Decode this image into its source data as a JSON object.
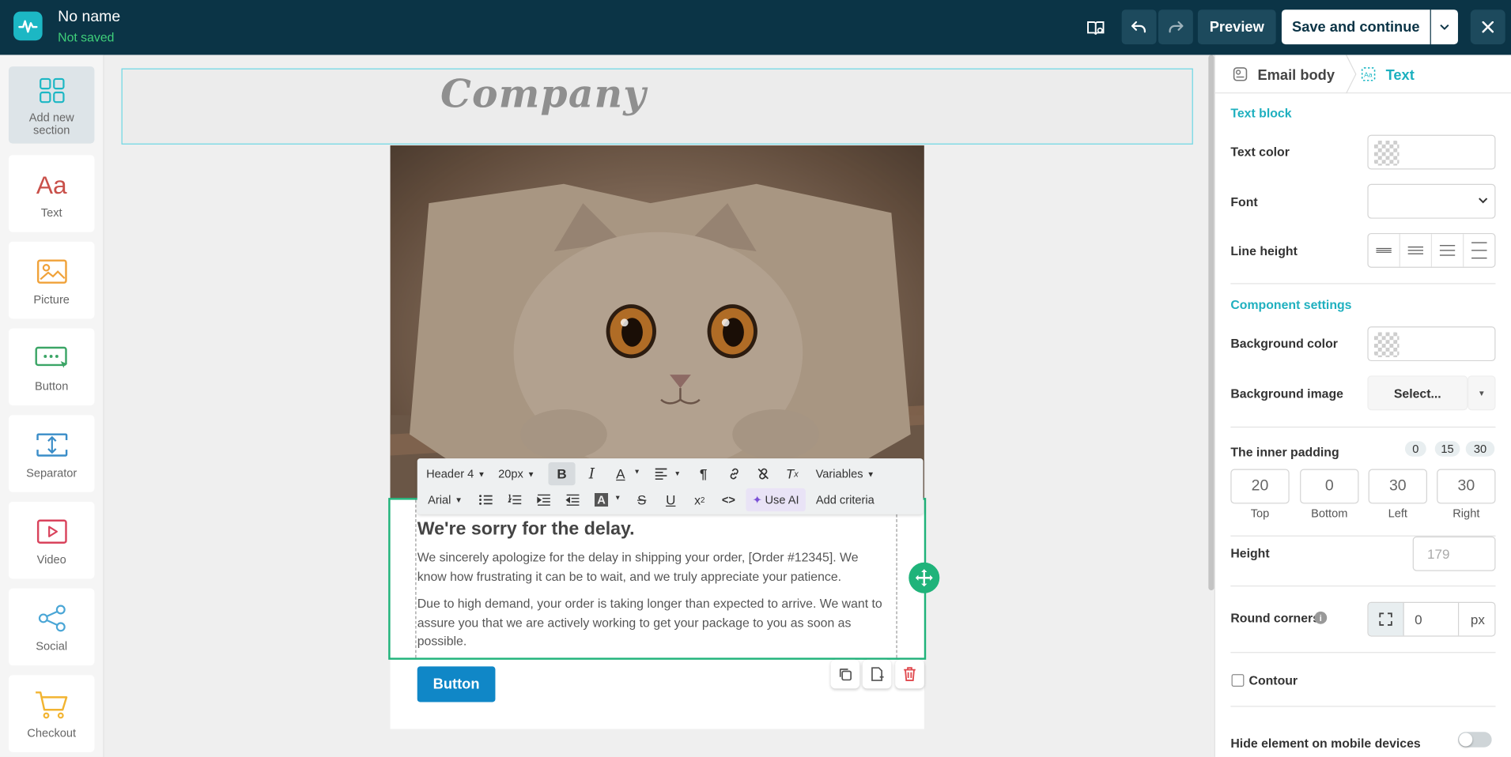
{
  "header": {
    "doc_name": "No name",
    "doc_status": "Not saved",
    "preview_label": "Preview",
    "save_label": "Save and continue"
  },
  "sidebar": {
    "items": [
      {
        "label": "Add new section",
        "icon": "grid-icon"
      },
      {
        "label": "Text",
        "icon": "text-icon",
        "glyph": "Aa"
      },
      {
        "label": "Picture",
        "icon": "picture-icon"
      },
      {
        "label": "Button",
        "icon": "button-icon"
      },
      {
        "label": "Separator",
        "icon": "separator-icon"
      },
      {
        "label": "Video",
        "icon": "video-icon"
      },
      {
        "label": "Social",
        "icon": "social-icon"
      },
      {
        "label": "Checkout",
        "icon": "cart-icon"
      }
    ]
  },
  "canvas": {
    "logo_text": "Company",
    "heading": "We're sorry for the delay.",
    "paragraph1": "We sincerely apologize for the delay in shipping your order, [Order #12345]. We know how frustrating it can be to wait, and we truly appreciate your patience.",
    "paragraph2": "Due to high demand, your order is taking longer than expected to arrive. We want to assure you that we are actively working to get your package to you as soon as possible.",
    "button_label": "Button"
  },
  "toolbar": {
    "heading_select": "Header 4",
    "size_select": "20px",
    "variables_label": "Variables",
    "font_select": "Arial",
    "ai_label": "Use AI",
    "criteria_label": "Add criteria"
  },
  "panel": {
    "tab_email_body": "Email body",
    "tab_text": "Text",
    "text_block_title": "Text block",
    "text_color_label": "Text color",
    "font_label": "Font",
    "line_height_label": "Line height",
    "component_settings_title": "Component settings",
    "bg_color_label": "Background color",
    "bg_image_label": "Background image",
    "bg_image_select": "Select...",
    "inner_padding_label": "The inner padding",
    "padding_presets": [
      "0",
      "15",
      "30"
    ],
    "padding": [
      {
        "value": "20",
        "label": "Top"
      },
      {
        "value": "0",
        "label": "Bottom"
      },
      {
        "value": "30",
        "label": "Left"
      },
      {
        "value": "30",
        "label": "Right"
      }
    ],
    "height_label": "Height",
    "height_placeholder": "179",
    "round_corners_label": "Round corners",
    "round_corners_value": "0",
    "round_corners_unit": "px",
    "contour_label": "Contour",
    "hide_mobile_label": "Hide element on mobile devices"
  },
  "colors": {
    "topbar": "#0b3446",
    "accent": "#1cb7c4",
    "selection_green": "#1fb37a",
    "email_button": "#1087c7",
    "status_green": "#3fd07a"
  }
}
